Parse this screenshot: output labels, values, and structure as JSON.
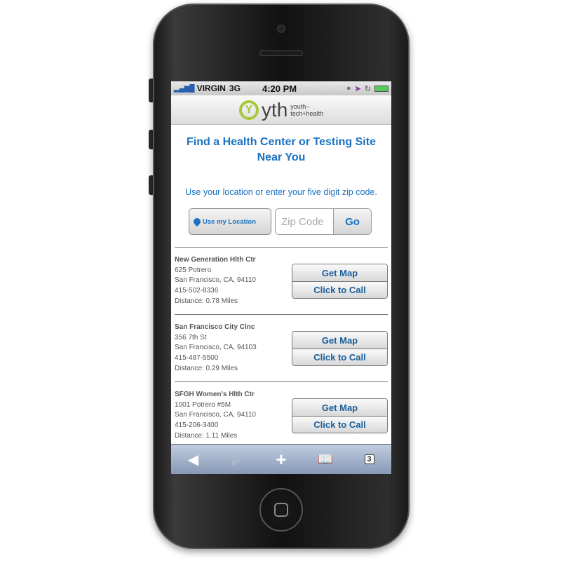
{
  "status_bar": {
    "carrier": "VIRGIN",
    "network": "3G",
    "time": "4:20 PM"
  },
  "header": {
    "logo_mark": "Y",
    "logo_text": "yth",
    "logo_sub_1": "youth–",
    "logo_sub_2": "tech+health"
  },
  "main": {
    "title": "Find a Health Center or Testing Site Near You",
    "instructions": "Use your location or enter your five digit zip code.",
    "use_location_label": "Use my Location",
    "zip_placeholder": "Zip Code",
    "go_label": "Go"
  },
  "results": [
    {
      "name": "New Generation Hlth Ctr",
      "address": "625 Potrero",
      "city": "San Francisco, CA, 94110",
      "phone": "415-502-8336",
      "distance": "Distance: 0.78 Miles",
      "map_label": "Get Map",
      "call_label": "Click to Call"
    },
    {
      "name": "San Francisco City Clnc",
      "address": "356 7th St",
      "city": "San Francisco, CA, 94103",
      "phone": "415-487-5500",
      "distance": "Distance: 0.29 Miles",
      "map_label": "Get Map",
      "call_label": "Click to Call"
    },
    {
      "name": "SFGH Women's Hlth Ctr",
      "address": "1001 Potrero #5M",
      "city": "San Francisco, CA, 94110",
      "phone": "415-206-3400",
      "distance": "Distance: 1.11 Miles",
      "map_label": "Get Map",
      "call_label": "Click to Call"
    }
  ],
  "toolbar": {
    "tabs_count": "3"
  },
  "colors": {
    "accent": "#1a72c0",
    "logo": "#a6c83a"
  }
}
